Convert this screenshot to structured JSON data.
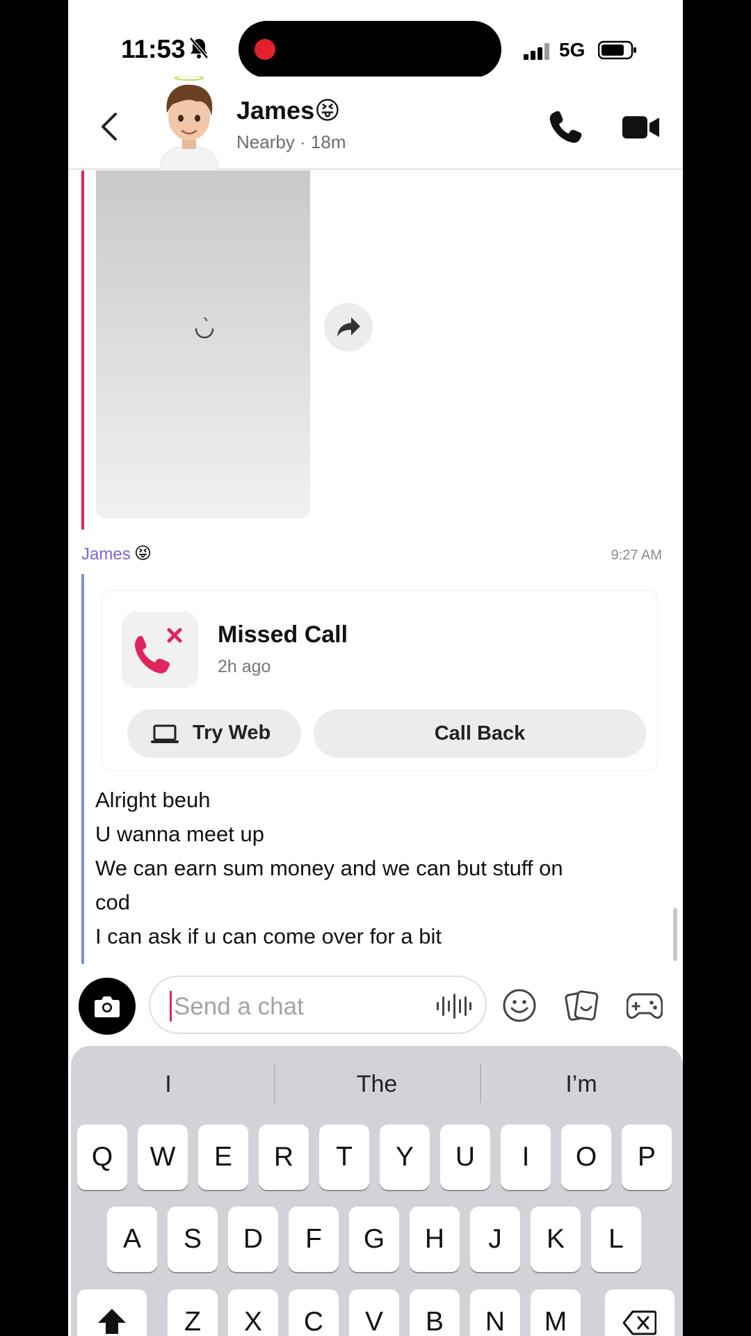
{
  "status_bar": {
    "time": "11:53",
    "network": "5G"
  },
  "header": {
    "contact_name": "James",
    "contact_emoji": "😝",
    "subtitle": "Nearby · 18m"
  },
  "chat": {
    "sender_name": "James",
    "sender_emoji": "😝",
    "message_time": "9:27 AM",
    "missed_call": {
      "title": "Missed Call",
      "time_ago": "2h ago",
      "try_web_label": "Try Web",
      "call_back_label": "Call Back"
    },
    "messages": [
      "Alright beuh",
      "U wanna meet up",
      "We can earn sum money and we can but stuff on",
      "cod",
      "I can ask if u can come over for a bit"
    ]
  },
  "input": {
    "placeholder": "Send a chat"
  },
  "keyboard": {
    "suggestions": [
      "I",
      "The",
      "I’m"
    ],
    "row1": [
      "Q",
      "W",
      "E",
      "R",
      "T",
      "Y",
      "U",
      "I",
      "O",
      "P"
    ],
    "row2": [
      "A",
      "S",
      "D",
      "F",
      "G",
      "H",
      "J",
      "K",
      "L"
    ],
    "row3": [
      "Z",
      "X",
      "C",
      "V",
      "B",
      "N",
      "M"
    ]
  },
  "colors": {
    "accent_red": "#e0245e",
    "sender_purple": "#7c64d8",
    "thread_bar_purple": "#7a8de0"
  }
}
